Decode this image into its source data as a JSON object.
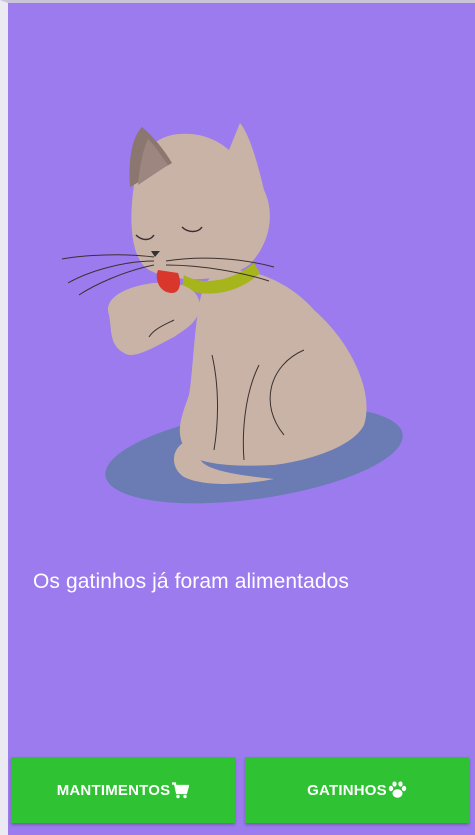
{
  "status": {
    "message": "Os gatinhos já foram alimentados"
  },
  "illustration": {
    "subject": "cat-grooming-illustration",
    "colors": {
      "background": "#9b7bee",
      "shadow": "#6b7bb4",
      "fur": "#c9b3a6",
      "ear_inner": "#8b7670",
      "collar": "#a6b51c",
      "tongue": "#d9362c"
    }
  },
  "bottom_nav": {
    "supplies_label": "MANTIMENTOS",
    "supplies_icon": "cart-icon",
    "kittens_label": "GATINHOS",
    "kittens_icon": "paw-icon"
  },
  "colors": {
    "button": "#2fc232",
    "button_text": "#ffffff"
  }
}
